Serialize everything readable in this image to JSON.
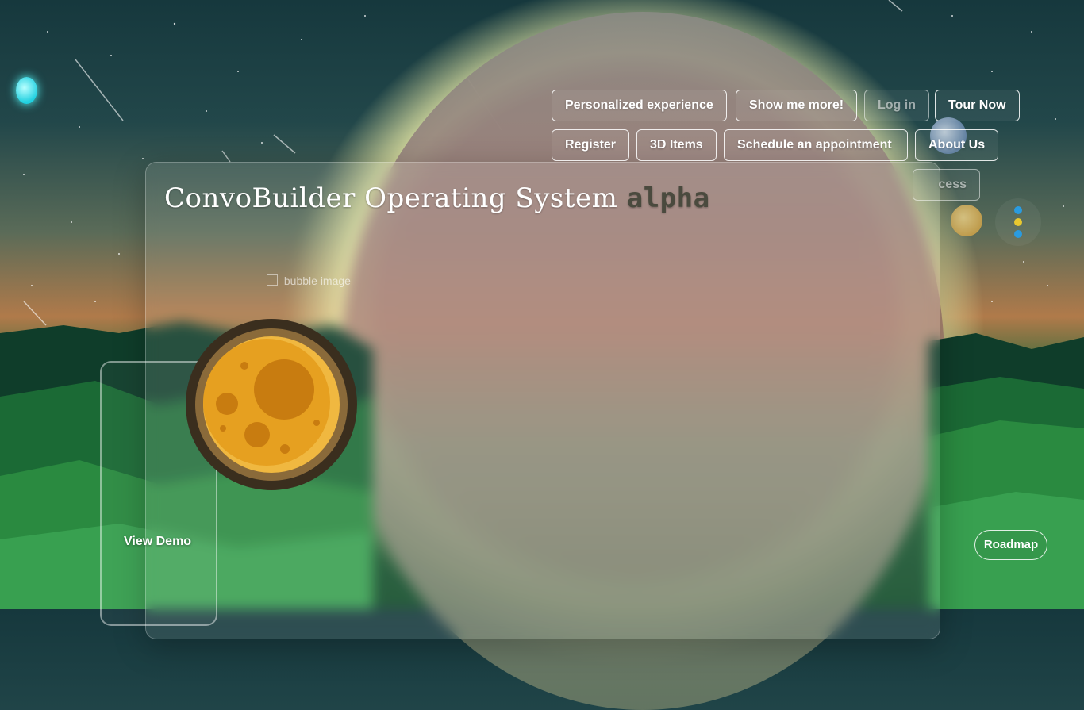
{
  "page": {
    "title_main": "ConvoBuilder Operating System",
    "title_badge": "alpha",
    "bubble_image_alt": "bubble image"
  },
  "nav": {
    "row1": [
      "Personalized experience",
      "Show me more!",
      "Log in",
      "Tour Now"
    ],
    "row2": [
      "Register",
      "3D Items",
      "Schedule an appointment",
      "About Us"
    ],
    "row3_partial": "cess"
  },
  "demo": {
    "label": "View Demo"
  },
  "roadmap": {
    "label": "Roadmap"
  },
  "menu_dots": {
    "colors": [
      "#2a9be0",
      "#e8c830",
      "#2a9be0"
    ]
  },
  "icons": [
    "moon-icon",
    "cyan-planet-icon",
    "earth-icon",
    "small-planet-icon",
    "menu-dots-icon"
  ],
  "colors": {
    "glow": "#f0f0b0",
    "moon": "#e8a020",
    "accent_text": "#4a4a3e"
  }
}
